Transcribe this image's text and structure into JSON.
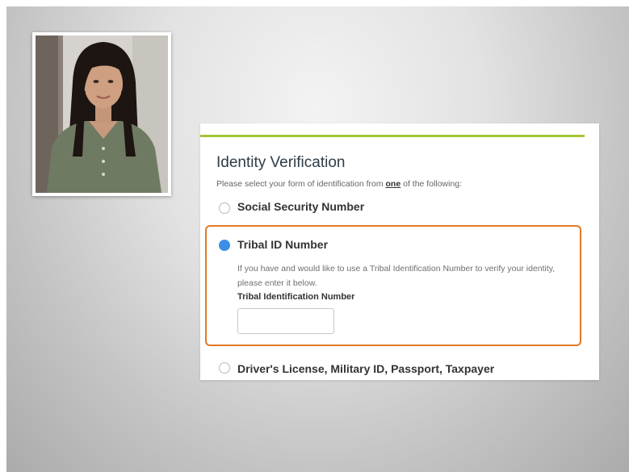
{
  "colors": {
    "accent_bar": "#a4c639",
    "selected_border": "#e07a24",
    "radio_selected": "#3d8fe6"
  },
  "presenter": {
    "icon": "presenter-photo"
  },
  "form": {
    "title": "Identity Verification",
    "instruction_before": "Please select your form of identification from ",
    "instruction_emphasis": "one",
    "instruction_after": " of the following:",
    "options": [
      {
        "label": "Social Security Number",
        "selected": false
      },
      {
        "label": "Tribal ID Number",
        "selected": true,
        "help_text": "If you have and would like to use a Tribal Identification Number to verify your identity, please enter it below.",
        "field_label": "Tribal Identification Number",
        "field_value": ""
      },
      {
        "label": "Driver's License, Military ID, Passport, Taxpayer Identification Number (TIN), or other Government ID",
        "selected": false
      }
    ]
  }
}
